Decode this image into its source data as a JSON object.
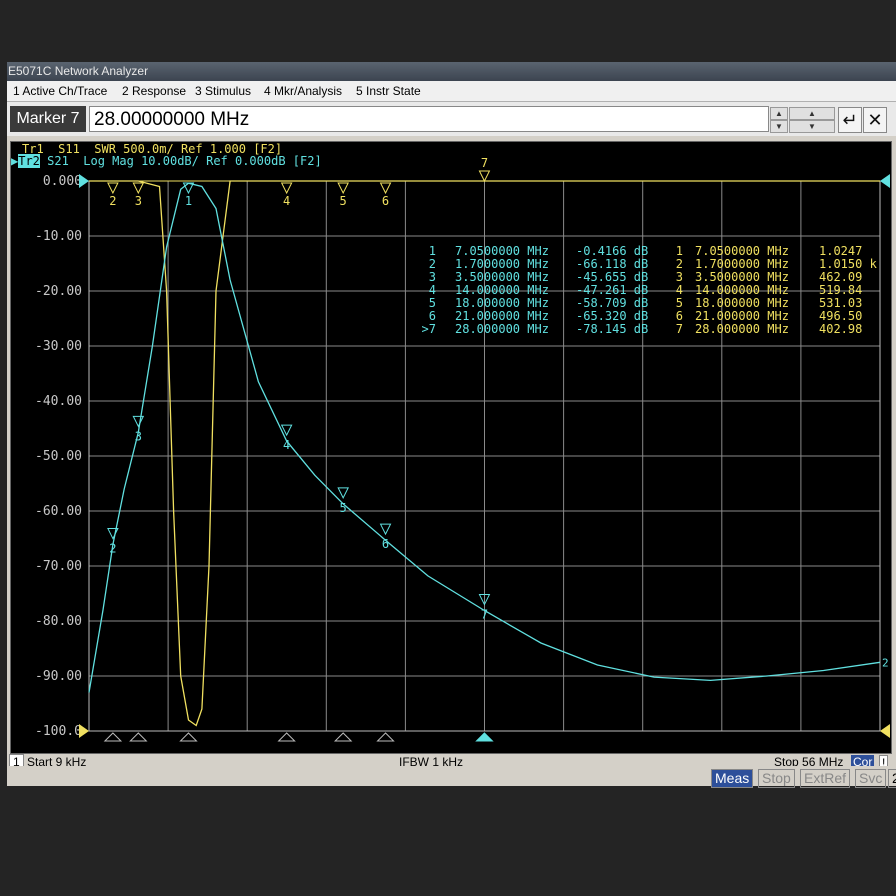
{
  "window": {
    "title": "E5071C Network Analyzer"
  },
  "menu": [
    "1 Active Ch/Trace",
    "2 Response",
    "3 Stimulus",
    "4 Mkr/Analysis",
    "5 Instr State"
  ],
  "entry": {
    "label": "Marker 7",
    "value": "28.00000000 MHz"
  },
  "traces": {
    "tr1": "Tr1  S11  SWR 500.0m/ Ref 1.000 [F2]",
    "tr2_tag": "Tr2",
    "tr2": " S21  Log Mag 10.00dB/ Ref 0.000dB [F2]"
  },
  "colors": {
    "tr1": "#f0e060",
    "tr2": "#60e0e0",
    "grid": "#8a8a8a",
    "tag_bg": "#60e0e0"
  },
  "chart_data": {
    "type": "line",
    "xlabel": "",
    "ylabel": "",
    "xlim": [
      0.009,
      56
    ],
    "ylim": [
      -100,
      0
    ],
    "y_tick_labels": [
      "0.000",
      "-10.00",
      "-20.00",
      "-30.00",
      "-40.00",
      "-50.00",
      "-60.00",
      "-70.00",
      "-80.00",
      "-90.00",
      "-100.0"
    ],
    "series": [
      {
        "name": "Tr1 S11 SWR",
        "x": [
          0.009,
          3.5,
          5.0,
          5.5,
          6.0,
          6.5,
          7.05,
          7.6,
          8.0,
          8.5,
          9.0,
          10,
          14,
          18,
          21,
          28,
          56
        ],
        "y": [
          0,
          0,
          -1.0,
          -20,
          -60,
          -90,
          -98,
          -99,
          -96,
          -70,
          -20,
          0,
          0,
          0,
          0,
          0,
          0
        ]
      },
      {
        "name": "Tr2 S21 Log Mag",
        "x": [
          0.009,
          1.0,
          1.7,
          2.5,
          3.5,
          4.5,
          5.5,
          6.5,
          7.05,
          8.0,
          9.0,
          10,
          12,
          14,
          16,
          18,
          21,
          24,
          28,
          32,
          36,
          40,
          44,
          48,
          52,
          56
        ],
        "y": [
          -93,
          -78,
          -66.1,
          -56,
          -45.7,
          -30,
          -12,
          -1.5,
          -0.4,
          -1.0,
          -5,
          -18,
          -36.5,
          -47.3,
          -53.5,
          -58.7,
          -65.3,
          -71.8,
          -78.1,
          -84,
          -88,
          -90.2,
          -90.8,
          -90,
          -89,
          -87.5
        ]
      }
    ],
    "markers_top": [
      {
        "label": "2",
        "x": 1.7
      },
      {
        "label": "3",
        "x": 3.5
      },
      {
        "label": "1",
        "x": 7.05
      },
      {
        "label": "4",
        "x": 14
      },
      {
        "label": "5",
        "x": 18
      },
      {
        "label": "6",
        "x": 21
      },
      {
        "label": "7",
        "x": 28
      }
    ],
    "marker_table": [
      {
        "n": "1",
        "f": "7.0500000 MHz",
        "v": "-0.4166 dB",
        "n2": "1",
        "f2": "7.0500000 MHz",
        "v2": "1.0247"
      },
      {
        "n": "2",
        "f": "1.7000000 MHz",
        "v": "-66.118 dB",
        "n2": "2",
        "f2": "1.7000000 MHz",
        "v2": "1.0150 k"
      },
      {
        "n": "3",
        "f": "3.5000000 MHz",
        "v": "-45.655 dB",
        "n2": "3",
        "f2": "3.5000000 MHz",
        "v2": "462.09"
      },
      {
        "n": "4",
        "f": "14.000000 MHz",
        "v": "-47.261 dB",
        "n2": "4",
        "f2": "14.000000 MHz",
        "v2": "519.84"
      },
      {
        "n": "5",
        "f": "18.000000 MHz",
        "v": "-58.709 dB",
        "n2": "5",
        "f2": "18.000000 MHz",
        "v2": "531.03"
      },
      {
        "n": "6",
        "f": "21.000000 MHz",
        "v": "-65.320 dB",
        "n2": "6",
        "f2": "21.000000 MHz",
        "v2": "496.50"
      },
      {
        "n": ">7",
        "f": "28.000000 MHz",
        "v": "-78.145 dB",
        "n2": "7",
        "f2": "28.000000 MHz",
        "v2": "402.98"
      }
    ]
  },
  "status": {
    "ch": "1",
    "start": "Start 9 kHz",
    "ifbw": "IFBW 1 kHz",
    "stop": "Stop 56 MHz",
    "cor": "Cor",
    "bang": "!"
  },
  "bottom": {
    "meas": "Meas",
    "stop": "Stop",
    "extref": "ExtRef",
    "svc": "Svc",
    "two": "2"
  }
}
